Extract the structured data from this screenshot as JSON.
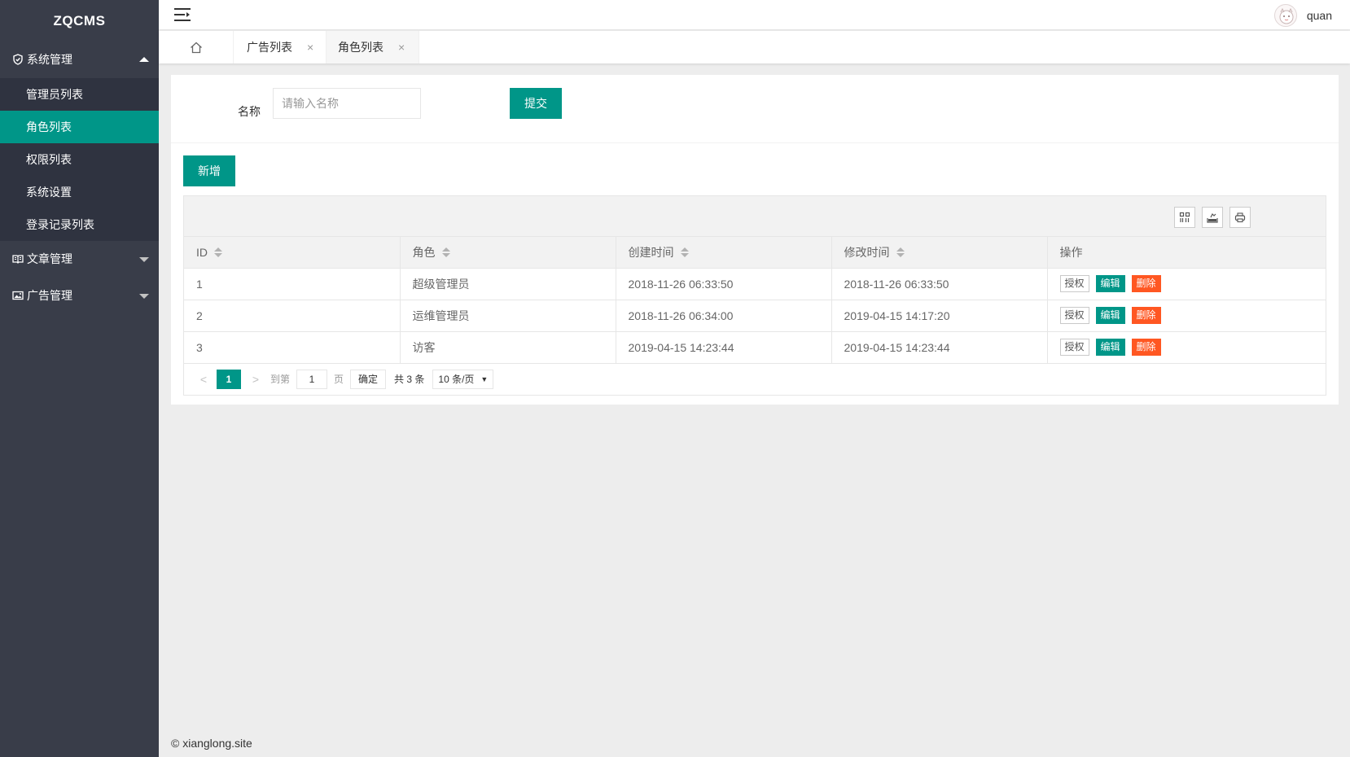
{
  "app": {
    "logo": "ZQCMS"
  },
  "sidebar": {
    "groups": [
      {
        "label": "系统管理",
        "icon": "shield-icon",
        "expanded": true,
        "items": [
          {
            "label": "管理员列表"
          },
          {
            "label": "角色列表",
            "active": true
          },
          {
            "label": "权限列表"
          },
          {
            "label": "系统设置"
          },
          {
            "label": "登录记录列表"
          }
        ]
      },
      {
        "label": "文章管理",
        "icon": "book-icon",
        "expanded": false
      },
      {
        "label": "广告管理",
        "icon": "image-icon",
        "expanded": false
      }
    ]
  },
  "header": {
    "user_name": "quan"
  },
  "tabs": [
    {
      "label": "广告列表",
      "close": "×"
    },
    {
      "label": "角色列表",
      "close": "×",
      "active": true
    }
  ],
  "search": {
    "label": "名称",
    "placeholder": "请输入名称",
    "submit_label": "提交"
  },
  "actions": {
    "add_label": "新增"
  },
  "table": {
    "columns": [
      "ID",
      "角色",
      "创建时间",
      "修改时间",
      "操作"
    ],
    "rows": [
      {
        "id": "1",
        "role": "超级管理员",
        "created": "2018-11-26 06:33:50",
        "modified": "2018-11-26 06:33:50"
      },
      {
        "id": "2",
        "role": "运维管理员",
        "created": "2018-11-26 06:34:00",
        "modified": "2019-04-15 14:17:20"
      },
      {
        "id": "3",
        "role": "访客",
        "created": "2019-04-15 14:23:44",
        "modified": "2019-04-15 14:23:44"
      }
    ],
    "row_actions": {
      "auth": "授权",
      "edit": "编辑",
      "delete": "删除"
    }
  },
  "pager": {
    "prev": "<",
    "current": "1",
    "next": ">",
    "goto_label": "到第",
    "goto_value": "1",
    "page_label": "页",
    "confirm": "确定",
    "total": "共 3 条",
    "page_size": "10 条/页",
    "page_size_arrow": "▼"
  },
  "footer": {
    "text": "© xianglong.site"
  },
  "colors": {
    "accent": "#009688",
    "danger": "#ff5722",
    "sidebar_bg": "#393d49",
    "sidebar_sub_bg": "#2f3340"
  }
}
